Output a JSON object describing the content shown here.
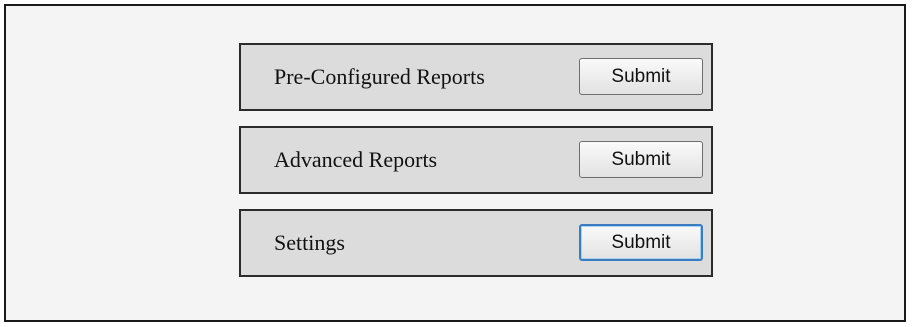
{
  "panels": [
    {
      "label": "Pre-Configured Reports",
      "button_label": "Submit"
    },
    {
      "label": "Advanced Reports",
      "button_label": "Submit"
    },
    {
      "label": "Settings",
      "button_label": "Submit"
    }
  ]
}
